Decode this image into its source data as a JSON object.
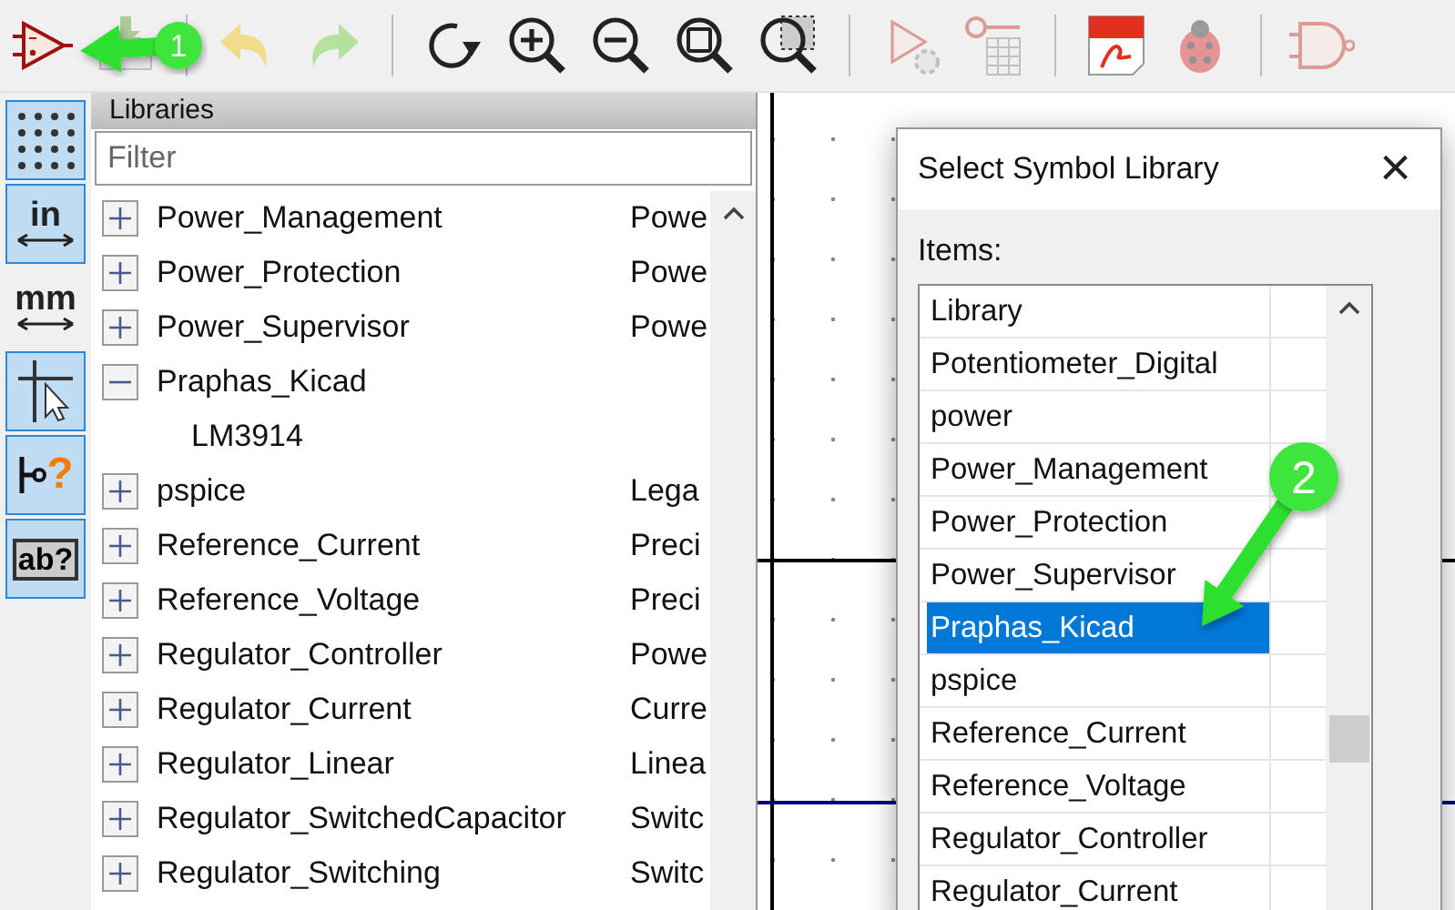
{
  "toolbar": [
    {
      "kind": "symbol",
      "disabled": false
    },
    {
      "kind": "save",
      "disabled": true
    },
    {
      "kind": "sep"
    },
    {
      "kind": "undo",
      "disabled": true
    },
    {
      "kind": "redo",
      "disabled": true
    },
    {
      "kind": "sep"
    },
    {
      "kind": "refresh",
      "disabled": false
    },
    {
      "kind": "zoom-in",
      "disabled": false
    },
    {
      "kind": "zoom-out",
      "disabled": false
    },
    {
      "kind": "zoom-fit",
      "disabled": false
    },
    {
      "kind": "zoom-area",
      "disabled": false
    },
    {
      "kind": "sep"
    },
    {
      "kind": "annotate",
      "disabled": true
    },
    {
      "kind": "table",
      "disabled": true
    },
    {
      "kind": "sep"
    },
    {
      "kind": "pdf",
      "disabled": false
    },
    {
      "kind": "bug",
      "disabled": true
    },
    {
      "kind": "sep"
    },
    {
      "kind": "gate",
      "disabled": true
    }
  ],
  "left_toolbar": [
    {
      "kind": "grid",
      "selected": true
    },
    {
      "kind": "units",
      "label": "in",
      "selected": true
    },
    {
      "kind": "units",
      "label": "mm",
      "selected": false
    },
    {
      "kind": "cursor",
      "selected": true
    },
    {
      "kind": "pin",
      "label": "?",
      "selected": true
    },
    {
      "kind": "text",
      "label": "ab?",
      "selected": true
    }
  ],
  "libraries_panel": {
    "title": "Libraries",
    "filter": {
      "placeholder": "Filter"
    },
    "items": [
      {
        "name": "Power_Management",
        "description": "Powe",
        "expanded": false
      },
      {
        "name": "Power_Protection",
        "description": "Powe",
        "expanded": false
      },
      {
        "name": "Power_Supervisor",
        "description": "Powe",
        "expanded": false
      },
      {
        "name": "Praphas_Kicad",
        "expanded": true,
        "children": [
          {
            "name": "LM3914"
          }
        ]
      },
      {
        "name": "pspice",
        "description": "Lega",
        "expanded": false
      },
      {
        "name": "Reference_Current",
        "description": "Preci",
        "expanded": false
      },
      {
        "name": "Reference_Voltage",
        "description": "Preci",
        "expanded": false
      },
      {
        "name": "Regulator_Controller",
        "description": "Powe",
        "expanded": false
      },
      {
        "name": "Regulator_Current",
        "description": "Curre",
        "expanded": false
      },
      {
        "name": "Regulator_Linear",
        "description": "Linea",
        "expanded": false
      },
      {
        "name": "Regulator_SwitchedCapacitor",
        "description": "Switc",
        "expanded": false
      },
      {
        "name": "Regulator_Switching",
        "description": "Switc",
        "expanded": false
      }
    ]
  },
  "dialog": {
    "title": "Select Symbol Library",
    "close": "×",
    "items_label": "Items:",
    "column": "Library",
    "items": [
      {
        "name": "Potentiometer_Digital",
        "selected": false
      },
      {
        "name": "power",
        "selected": false
      },
      {
        "name": "Power_Management",
        "selected": false
      },
      {
        "name": "Power_Protection",
        "selected": false
      },
      {
        "name": "Power_Supervisor",
        "selected": false
      },
      {
        "name": "Praphas_Kicad",
        "selected": true
      },
      {
        "name": "pspice",
        "selected": false
      },
      {
        "name": "Reference_Current",
        "selected": false
      },
      {
        "name": "Reference_Voltage",
        "selected": false
      },
      {
        "name": "Regulator_Controller",
        "selected": false
      },
      {
        "name": "Regulator_Current",
        "selected": false
      }
    ]
  },
  "callouts": [
    {
      "label": "1"
    },
    {
      "label": "2"
    }
  ]
}
